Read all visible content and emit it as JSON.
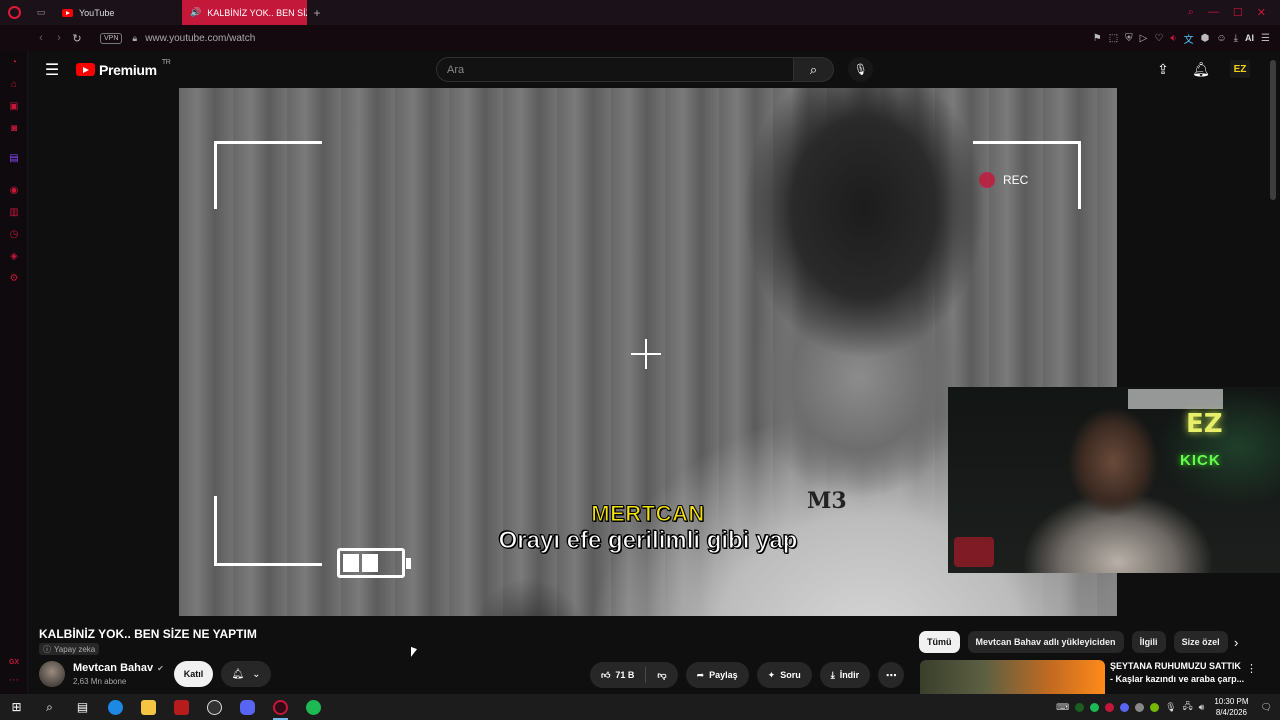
{
  "browser": {
    "tabs": [
      {
        "label": "YouTube"
      },
      {
        "label": "KALBİNİZ YOK.. BEN SİZ"
      }
    ],
    "address": {
      "vpn_label": "VPN",
      "url": "www.youtube.com/watch"
    },
    "ai_label": "AI"
  },
  "youtube": {
    "logo_text": "Premium",
    "region": "TR",
    "search": {
      "placeholder": "Ara",
      "value": ""
    },
    "avatar_text": "EZ"
  },
  "video": {
    "rec_label": "REC",
    "subtitle_speaker": "MERTCAN",
    "subtitle_text": "Orayı efe gerilimli gibi yap",
    "logo_mark": "M3"
  },
  "webcam": {
    "neon_top": "EZ",
    "neon_bottom": "KICK"
  },
  "info": {
    "title": "KALBİNİZ YOK.. BEN SİZE NE YAPTIM",
    "ai_badge": "Yapay zeka",
    "channel_name": "Mevtcan Bahav",
    "subscribers": "2,63 Mn abone",
    "join_label": "Katıl",
    "like_count": "71 B",
    "share_label": "Paylaş",
    "ask_label": "Soru",
    "download_label": "İndir"
  },
  "chips": [
    {
      "label": "Tümü",
      "active": true
    },
    {
      "label": "Mevtcan Bahav adlı yükleyiciden"
    },
    {
      "label": "İlgili"
    },
    {
      "label": "Size özel"
    }
  ],
  "recommendation": {
    "title_line1": "ŞEYTANA RUHUMUZU SATTIK",
    "title_line2": "- Kaşlar kazındı ve araba çarp..."
  },
  "taskbar": {
    "time": "10:30 PM",
    "date": "8/4/2026"
  },
  "colors": {
    "opera_red": "#c4183a",
    "youtube_red": "#ff0000",
    "subtitle_yellow": "#f2e20a",
    "background": "#0f0f0f"
  }
}
